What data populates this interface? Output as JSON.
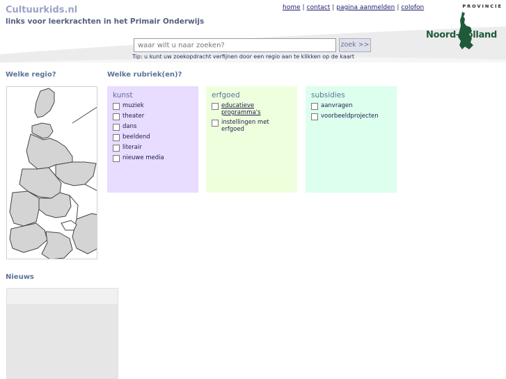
{
  "header": {
    "site_title": "Cultuurkids.nl",
    "subtitle": "links voor leerkrachten in het Primair Onderwijs",
    "links": [
      "home",
      "contact",
      "pagina aanmelden",
      "colofon"
    ]
  },
  "logo": {
    "provincie": "PROVINCIE",
    "name": "Noord-Holland",
    "color": "#1f5a3a"
  },
  "search": {
    "placeholder": "waar wilt u naar zoeken?",
    "button": "zoek >>",
    "tip": "Tip: u kunt uw zoekopdracht verfijnen door een regio aan te klikken op de kaart"
  },
  "region": {
    "heading": "Welke regio?"
  },
  "rubrieken": {
    "heading": "Welke rubriek(en)?",
    "categories": [
      {
        "title": "kunst",
        "color": "#e8dcff",
        "items": [
          "muziek",
          "theater",
          "dans",
          "beeldend",
          "literair",
          "nieuwe media"
        ]
      },
      {
        "title": "erfgoed",
        "color": "#eeffdd",
        "items": [
          "educatieve programma's",
          "instellingen met erfgoed"
        ]
      },
      {
        "title": "subsidies",
        "color": "#ddffee",
        "items": [
          "aanvragen",
          "voorbeeldprojecten"
        ]
      }
    ]
  },
  "news": {
    "heading": "Nieuws"
  }
}
